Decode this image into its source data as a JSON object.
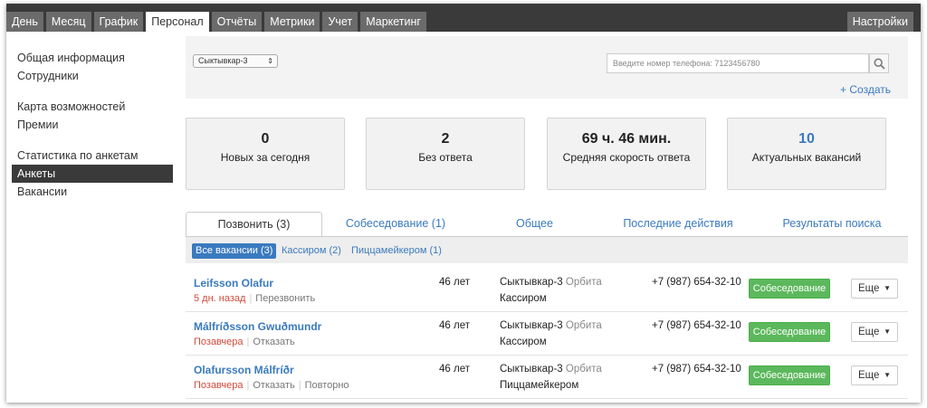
{
  "topnav": {
    "tabs": [
      "День",
      "Месяц",
      "График",
      "Персонал",
      "Отчёты",
      "Метрики",
      "Учет",
      "Маркетинг"
    ],
    "active_tab": "Персонал",
    "settings_label": "Настройки"
  },
  "sidebar": {
    "groups": [
      [
        "Общая информация",
        "Сотрудники"
      ],
      [
        "Карта возможностей",
        "Премии"
      ],
      [
        "Статистика по анкетам",
        "Анкеты",
        "Вакансии"
      ]
    ],
    "active_item": "Анкеты"
  },
  "filter": {
    "location_select": "Сыктывкар-3",
    "phone_placeholder": "Введите номер телефона: 7123456780",
    "create_label": "+ Создать"
  },
  "stats": [
    {
      "value": "0",
      "label": "Новых за сегодня",
      "highlight": false
    },
    {
      "value": "2",
      "label": "Без ответа",
      "highlight": false
    },
    {
      "value": "69 ч. 46 мин.",
      "label": "Средняя скорость ответа",
      "highlight": false
    },
    {
      "value": "10",
      "label": "Актуальных вакансий",
      "highlight": true
    }
  ],
  "tabs": {
    "items": [
      "Позвонить (3)",
      "Собеседование (1)",
      "Общее",
      "Последние действия",
      "Результаты поиска"
    ],
    "active": "Позвонить (3)"
  },
  "subfilters": {
    "items": [
      "Все вакансии (3)",
      "Кассиром (2)",
      "Пиццамейкером (1)"
    ],
    "active": "Все вакансии (3)"
  },
  "rows": [
    {
      "name": "Leifsson Olafur",
      "time": "5 дн. назад",
      "actions": [
        "Перезвонить"
      ],
      "age": "46 лет",
      "city": "Сыктывкар-3",
      "branch": "Орбита",
      "role": "Кассиром",
      "phone": "+7 (987) 654-32-10",
      "primary": "Собеседование",
      "more": "Еще"
    },
    {
      "name": "Málfríðsson Gwuðmundr",
      "time": "Позавчера",
      "actions": [
        "Отказать"
      ],
      "age": "46 лет",
      "city": "Сыктывкар-3",
      "branch": "Орбита",
      "role": "Кассиром",
      "phone": "+7 (987) 654-32-10",
      "primary": "Собеседование",
      "more": "Еще"
    },
    {
      "name": "Olafursson Málfríðr",
      "time": "Позавчера",
      "actions": [
        "Отказать",
        "Повторно"
      ],
      "age": "46 лет",
      "city": "Сыктывкар-3",
      "branch": "Орбита",
      "role": "Пиццамейкером",
      "phone": "+7 (987) 654-32-10",
      "primary": "Собеседование",
      "more": "Еще"
    }
  ],
  "colors": {
    "accent": "#3a7abf",
    "nav_bg": "#3a3a3a",
    "success": "#5cb85c",
    "danger": "#d04a3a"
  },
  "icons": {
    "search": "search-icon",
    "select": "chevron-updown-icon",
    "more": "caret-down-icon"
  }
}
